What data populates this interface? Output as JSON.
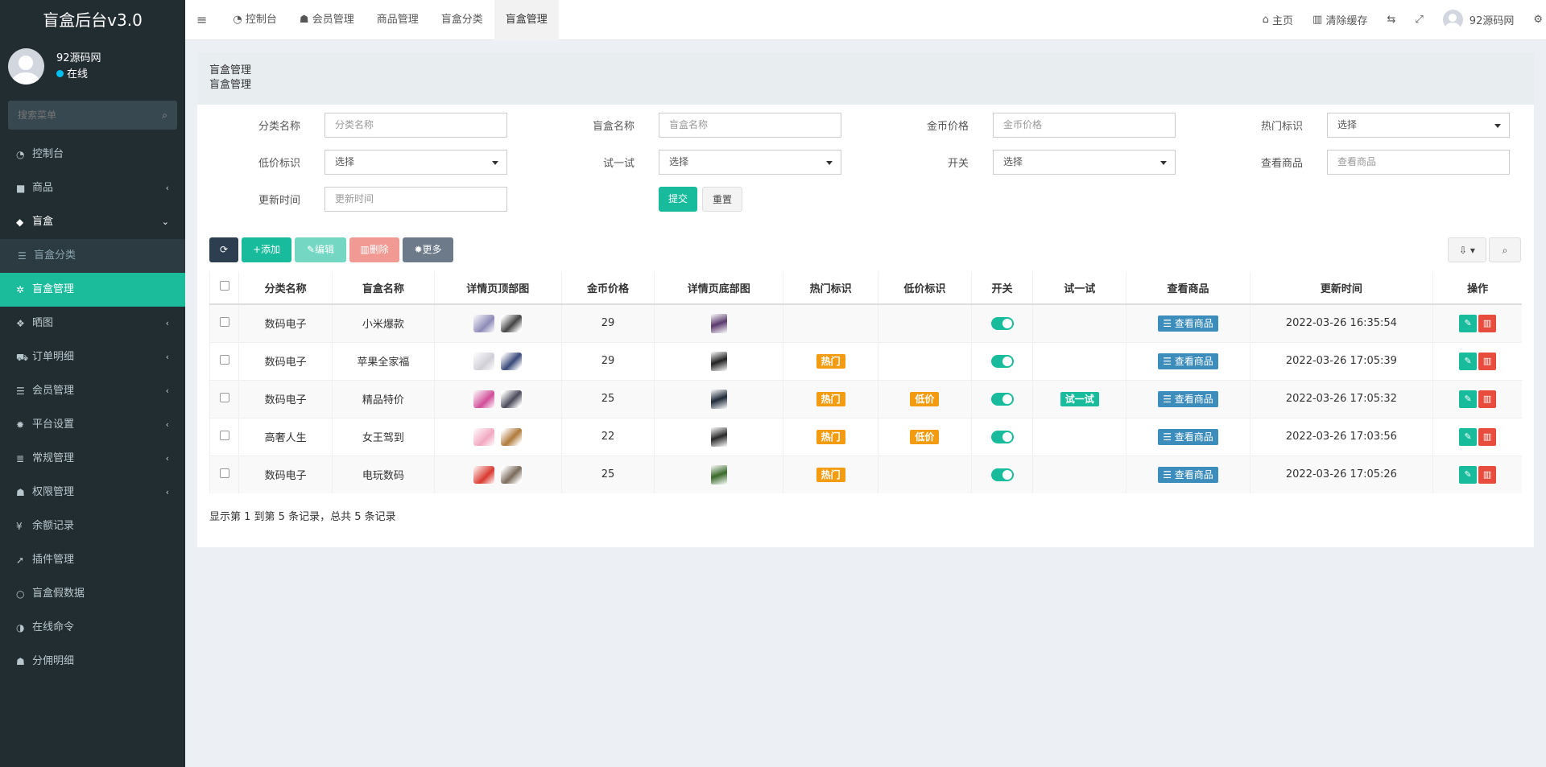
{
  "app": {
    "logo_text": "盲盒后台v3.0",
    "user_name": "92源码网",
    "user_status": "在线",
    "search_placeholder": "搜索菜单"
  },
  "sidebar": {
    "items": [
      {
        "label": "控制台",
        "icon": "dashboard-icon",
        "glyph": "◔",
        "arrow": ""
      },
      {
        "label": "商品",
        "icon": "briefcase-icon",
        "glyph": "■",
        "arrow": "‹"
      },
      {
        "label": "盲盒",
        "icon": "cube-icon",
        "glyph": "◆",
        "arrow": "⌄"
      },
      {
        "label": "盲盒分类",
        "icon": "list-icon",
        "glyph": "☰",
        "arrow": ""
      },
      {
        "label": "盲盒管理",
        "icon": "cubes-icon",
        "glyph": "✲",
        "arrow": ""
      },
      {
        "label": "晒图",
        "icon": "dropbox-icon",
        "glyph": "❖",
        "arrow": "‹"
      },
      {
        "label": "订单明细",
        "icon": "cart-icon",
        "glyph": "⛟",
        "arrow": "‹"
      },
      {
        "label": "会员管理",
        "icon": "list-icon",
        "glyph": "☰",
        "arrow": "‹"
      },
      {
        "label": "平台设置",
        "icon": "gear-icon",
        "glyph": "✹",
        "arrow": "‹"
      },
      {
        "label": "常规管理",
        "icon": "database-icon",
        "glyph": "≣",
        "arrow": "‹"
      },
      {
        "label": "权限管理",
        "icon": "group-icon",
        "glyph": "☗",
        "arrow": "‹"
      },
      {
        "label": "余额记录",
        "icon": "yen-icon",
        "glyph": "¥",
        "arrow": ""
      },
      {
        "label": "插件管理",
        "icon": "rocket-icon",
        "glyph": "➚",
        "arrow": ""
      },
      {
        "label": "盲盒假数据",
        "icon": "circle-icon",
        "glyph": "○",
        "arrow": ""
      },
      {
        "label": "在线命令",
        "icon": "adjust-icon",
        "glyph": "◑",
        "arrow": ""
      },
      {
        "label": "分佣明细",
        "icon": "users-icon",
        "glyph": "☗",
        "arrow": ""
      }
    ]
  },
  "topbar": {
    "menu_glyph": "≡",
    "tabs": [
      {
        "label": "控制台",
        "glyph": "◔"
      },
      {
        "label": "会员管理",
        "glyph": "☗"
      },
      {
        "label": "商品管理",
        "glyph": ""
      },
      {
        "label": "盲盒分类",
        "glyph": ""
      },
      {
        "label": "盲盒管理",
        "glyph": ""
      }
    ],
    "home": "主页",
    "clear_cache": "清除缓存",
    "username": "92源码网"
  },
  "page": {
    "breadcrumb_title": "盲盒管理",
    "breadcrumb_sub": "盲盒管理"
  },
  "filters": {
    "category": {
      "label": "分类名称",
      "placeholder": "分类名称"
    },
    "name": {
      "label": "盲盒名称",
      "placeholder": "盲盒名称"
    },
    "price": {
      "label": "金币价格",
      "placeholder": "金币价格"
    },
    "hot": {
      "label": "热门标识",
      "value": "选择"
    },
    "low": {
      "label": "低价标识",
      "value": "选择"
    },
    "try": {
      "label": "试一试",
      "value": "选择"
    },
    "switch": {
      "label": "开关",
      "value": "选择"
    },
    "goods": {
      "label": "查看商品",
      "placeholder": "查看商品"
    },
    "updated": {
      "label": "更新时间",
      "placeholder": "更新时间"
    },
    "submit": "提交",
    "reset": "重置"
  },
  "toolbar": {
    "refresh_glyph": "⟳",
    "add": "添加",
    "edit": "编辑",
    "delete": "删除",
    "more": "更多"
  },
  "table": {
    "headers": [
      "分类名称",
      "盲盒名称",
      "详情页顶部图",
      "金币价格",
      "详情页底部图",
      "热门标识",
      "低价标识",
      "开关",
      "试一试",
      "查看商品",
      "更新时间",
      "操作"
    ],
    "view_label": "查看商品",
    "rows": [
      {
        "category": "数码电子",
        "name": "小米爆款",
        "price": "29",
        "hot": "",
        "low": "",
        "try": "",
        "updated": "2022-03-26 16:35:54"
      },
      {
        "category": "数码电子",
        "name": "苹果全家福",
        "price": "29",
        "hot": "热门",
        "low": "",
        "try": "",
        "updated": "2022-03-26 17:05:39"
      },
      {
        "category": "数码电子",
        "name": "精品特价",
        "price": "25",
        "hot": "热门",
        "low": "低价",
        "try": "试一试",
        "updated": "2022-03-26 17:05:32"
      },
      {
        "category": "高奢人生",
        "name": "女王驾到",
        "price": "22",
        "hot": "热门",
        "low": "低价",
        "try": "",
        "updated": "2022-03-26 17:03:56"
      },
      {
        "category": "数码电子",
        "name": "电玩数码",
        "price": "25",
        "hot": "热门",
        "low": "",
        "try": "",
        "updated": "2022-03-26 17:05:26"
      }
    ],
    "thumb_colors": [
      [
        "#8e8ab8",
        "#444444",
        "#5b3a6e"
      ],
      [
        "#cfcfd6",
        "#3a4a7a",
        "#222222"
      ],
      [
        "#d14e9a",
        "#4a4a5a",
        "#1e2a3a"
      ],
      [
        "#f2a7c0",
        "#b07a3a",
        "#2a2a2a"
      ],
      [
        "#d9392f",
        "#7a6a5a",
        "#3a6a2a"
      ]
    ]
  },
  "footer": {
    "summary": "显示第 1 到第 5 条记录，总共 5 条记录"
  }
}
